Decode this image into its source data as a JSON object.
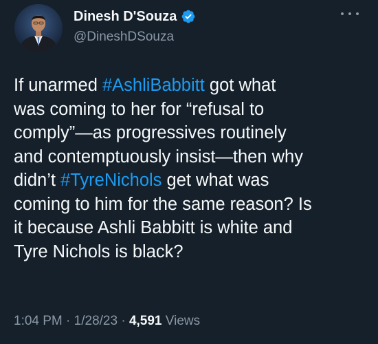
{
  "author": {
    "display_name": "Dinesh D'Souza",
    "handle": "@DineshDSouza",
    "verified_icon": "verified-badge-icon",
    "avatar_icon": "profile-photo"
  },
  "menu_icon": "more-options-icon",
  "tweet": {
    "lines": [
      {
        "pre": "If unarmed ",
        "tag": "#AshliBabbitt",
        "post": " got what"
      },
      {
        "text": "was coming to her for “refusal to"
      },
      {
        "text": "comply”—as progressives routinely"
      },
      {
        "text": "and contemptuously insist—then why"
      },
      {
        "pre": "didn’t ",
        "tag": "#TyreNichols",
        "post": " get what was"
      },
      {
        "text": "coming to him for the same reason? Is"
      },
      {
        "text": "it because Ashli Babbitt is white and"
      },
      {
        "text": "Tyre Nichols is black?"
      }
    ]
  },
  "meta": {
    "time": "1:04 PM",
    "separator": "·",
    "date": "1/28/23",
    "views_count": "4,591",
    "views_label": "Views"
  },
  "colors": {
    "background": "#15202b",
    "text": "#f7f9f9",
    "secondary": "#8b98a5",
    "accent": "#1d9bf0"
  }
}
